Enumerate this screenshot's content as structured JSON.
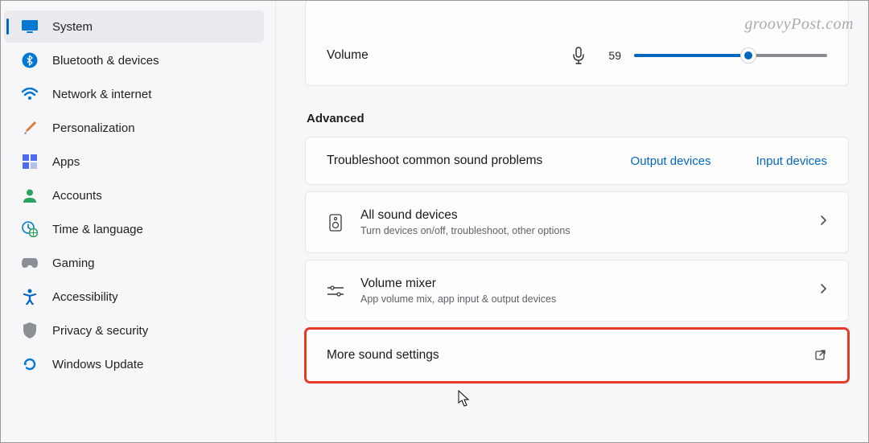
{
  "sidebar": {
    "items": [
      {
        "label": "System"
      },
      {
        "label": "Bluetooth & devices"
      },
      {
        "label": "Network & internet"
      },
      {
        "label": "Personalization"
      },
      {
        "label": "Apps"
      },
      {
        "label": "Accounts"
      },
      {
        "label": "Time & language"
      },
      {
        "label": "Gaming"
      },
      {
        "label": "Accessibility"
      },
      {
        "label": "Privacy & security"
      },
      {
        "label": "Windows Update"
      }
    ]
  },
  "volume": {
    "label": "Volume",
    "value": "59",
    "percent": 59
  },
  "advanced": {
    "heading": "Advanced",
    "troubleshoot": {
      "title": "Troubleshoot common sound problems",
      "output_link": "Output devices",
      "input_link": "Input devices"
    },
    "all_devices": {
      "title": "All sound devices",
      "sub": "Turn devices on/off, troubleshoot, other options"
    },
    "mixer": {
      "title": "Volume mixer",
      "sub": "App volume mix, app input & output devices"
    },
    "more": {
      "title": "More sound settings"
    }
  },
  "watermark": "groovyPost.com"
}
